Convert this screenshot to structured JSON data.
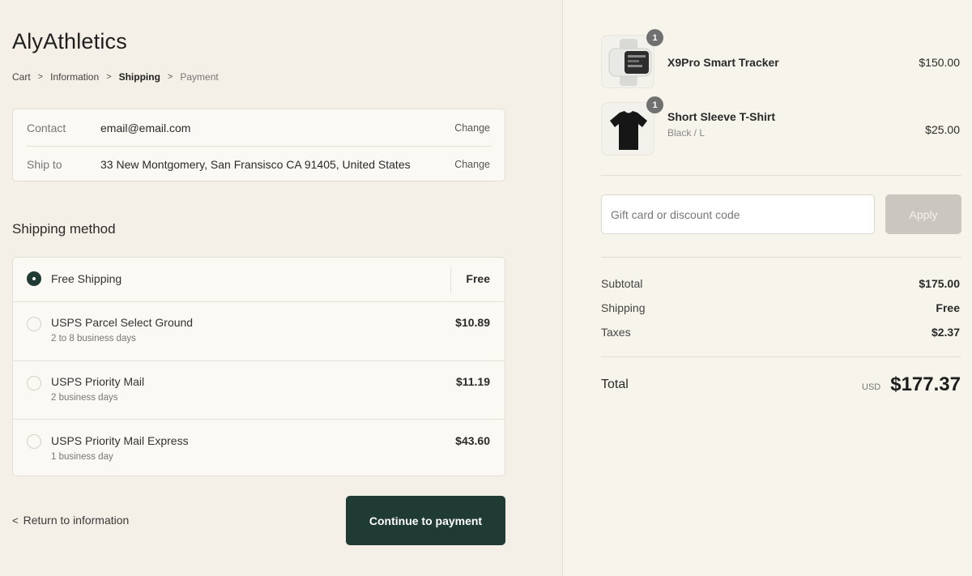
{
  "brand": "AlyAthletics",
  "breadcrumb": [
    "Cart",
    "Information",
    "Shipping",
    "Payment"
  ],
  "contact": {
    "label": "Contact",
    "value": "email@email.com",
    "change": "Change"
  },
  "ship_to": {
    "label": "Ship to",
    "value": "33 New Montgomery, San Fransisco CA 91405, United States",
    "change": "Change"
  },
  "shipping_method": {
    "title": "Shipping method",
    "options": [
      {
        "name": "Free Shipping",
        "sub": "",
        "price": "Free",
        "selected": true
      },
      {
        "name": "USPS Parcel Select Ground",
        "sub": "2 to 8 business days",
        "price": "$10.89",
        "selected": false
      },
      {
        "name": "USPS Priority Mail",
        "sub": "2 business days",
        "price": "$11.19",
        "selected": false
      },
      {
        "name": "USPS Priority Mail Express",
        "sub": "1 business day",
        "price": "$43.60",
        "selected": false
      }
    ]
  },
  "footer": {
    "return_label": "Return to information",
    "continue_label": "Continue to payment"
  },
  "cart": {
    "items": [
      {
        "name": "X9Pro Smart Tracker",
        "variant": "",
        "price": "$150.00",
        "quantity": "1",
        "icon": "smartwatch-icon"
      },
      {
        "name": "Short Sleeve T-Shirt",
        "variant": "Black / L",
        "price": "$25.00",
        "quantity": "1",
        "icon": "tshirt-icon"
      }
    ],
    "discount": {
      "placeholder": "Gift card or discount code",
      "apply_label": "Apply"
    },
    "summary": {
      "subtotal_label": "Subtotal",
      "subtotal": "$175.00",
      "shipping_label": "Shipping",
      "shipping": "Free",
      "taxes_label": "Taxes",
      "taxes": "$2.37"
    },
    "total": {
      "label": "Total",
      "currency": "USD",
      "amount": "$177.37"
    }
  },
  "colors": {
    "accent": "#1f3b33",
    "background": "#f4f0e7"
  }
}
